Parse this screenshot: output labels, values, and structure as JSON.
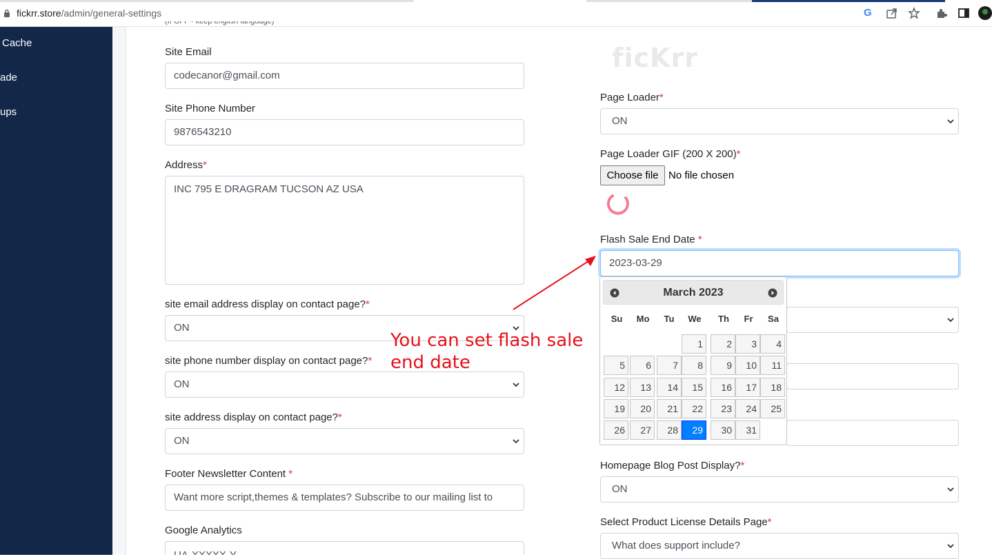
{
  "browser": {
    "url_host": "fickrr.store",
    "url_path": "/admin/general-settings"
  },
  "sidebar": {
    "items": [
      "Cache",
      "ade",
      "ups"
    ]
  },
  "left_column": {
    "top_note": "(If OFF - keep english language)",
    "site_email": {
      "label": "Site Email",
      "value": "codecanor@gmail.com"
    },
    "site_phone": {
      "label": "Site Phone Number",
      "value": "9876543210"
    },
    "address": {
      "label": "Address",
      "value": "INC 795 E DRAGRAM TUCSON AZ USA"
    },
    "email_display": {
      "label": "site email address display on contact page?",
      "value": "ON"
    },
    "phone_display": {
      "label": "site phone number display on contact page?",
      "value": "ON"
    },
    "address_display": {
      "label": "site address display on contact page?",
      "value": "ON"
    },
    "footer_newsletter": {
      "label": "Footer Newsletter Content ",
      "value": "Want more script,themes & templates? Subscribe to our mailing list to"
    },
    "google_analytics": {
      "label": "Google Analytics",
      "value": "UA-XXXXX-Y"
    }
  },
  "right_column": {
    "logo_text": "ficKrr",
    "page_loader": {
      "label": "Page Loader",
      "value": "ON"
    },
    "page_loader_gif": {
      "label": "Page Loader GIF (200 X 200)",
      "button": "Choose file",
      "status": "No file chosen"
    },
    "flash_sale": {
      "label": "Flash Sale End Date ",
      "value": "2023-03-29"
    },
    "blog_post_display": {
      "label": "Homepage Blog Post Display?",
      "value": "ON"
    },
    "license_page": {
      "label": "Select Product License Details Page",
      "value": "What does support include?"
    }
  },
  "required_mark": "*",
  "datepicker": {
    "title": "March 2023",
    "weekdays": [
      "Su",
      "Mo",
      "Tu",
      "We",
      "Th",
      "Fr",
      "Sa"
    ],
    "selected": "29",
    "weeks": [
      [
        "",
        "",
        "",
        "1",
        "2",
        "3",
        "4"
      ],
      [
        "5",
        "6",
        "7",
        "8",
        "9",
        "10",
        "11"
      ],
      [
        "12",
        "13",
        "14",
        "15",
        "16",
        "17",
        "18"
      ],
      [
        "19",
        "20",
        "21",
        "22",
        "23",
        "24",
        "25"
      ],
      [
        "26",
        "27",
        "28",
        "29",
        "30",
        "31",
        ""
      ]
    ]
  },
  "annotation": {
    "line1": "You can set flash sale",
    "line2": "end date",
    "color": "#e8101a"
  }
}
